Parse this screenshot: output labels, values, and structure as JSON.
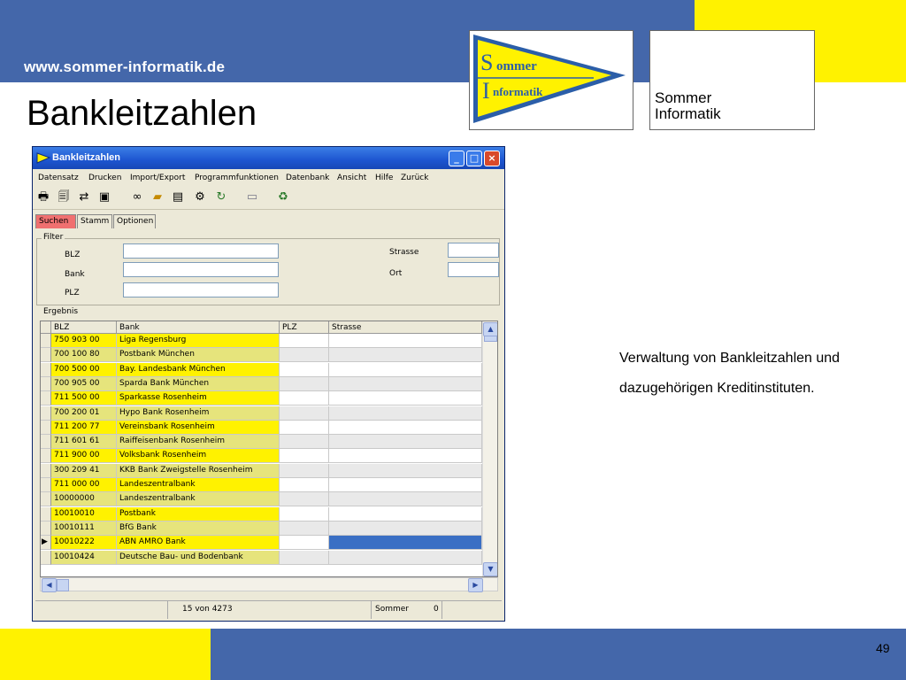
{
  "slide": {
    "site_url": "www.sommer-informatik.de",
    "title": "Bankleitzahlen",
    "page_number": "49",
    "description": [
      "Verwaltung von Bankleitzahlen und",
      "dazugehörigen Kreditinstituten."
    ],
    "logo_pennant": {
      "line1_initial": "S",
      "line1_rest": "ommer",
      "line2_initial": "I",
      "line2_rest": "nformatik"
    },
    "logo_text": {
      "line1": "Sommer",
      "line2": "Informatik"
    },
    "colors": {
      "blue": "#4467aa",
      "yellow": "#fff200"
    }
  },
  "window": {
    "title": "Bankleitzahlen",
    "menu": [
      "Datensatz",
      "Drucken",
      "Import/Export",
      "Programmfunktionen",
      "Datenbank",
      "Ansicht",
      "Hilfe",
      "Zurück"
    ],
    "toolbar_icons": [
      "print-icon",
      "print-preview-icon",
      "network-icon",
      "excel-icon",
      "binoculars-icon",
      "folder-refresh-icon",
      "document-icon",
      "gear-icon",
      "refresh-icon",
      "save-icon",
      "recycle-bin-icon"
    ],
    "tabs": [
      "Suchen",
      "Stamm",
      "Optionen"
    ],
    "filter": {
      "legend": "Filter",
      "blz_label": "BLZ",
      "bank_label": "Bank",
      "plz_label": "PLZ",
      "strasse_label": "Strasse",
      "ort_label": "Ort",
      "blz_value": "",
      "bank_value": "",
      "plz_value": "",
      "strasse_value": "",
      "ort_value": ""
    },
    "results": {
      "legend": "Ergebnis",
      "columns": [
        "BLZ",
        "Bank",
        "PLZ",
        "Strasse"
      ],
      "rows": [
        {
          "blz": "750 903 00",
          "bank": "Liga Regensburg"
        },
        {
          "blz": "700 100 80",
          "bank": "Postbank München"
        },
        {
          "blz": "700 500 00",
          "bank": "Bay. Landesbank München"
        },
        {
          "blz": "700 905 00",
          "bank": "Sparda Bank München"
        },
        {
          "blz": "711 500 00",
          "bank": "Sparkasse Rosenheim"
        },
        {
          "blz": "700 200 01",
          "bank": "Hypo Bank Rosenheim"
        },
        {
          "blz": "711 200 77",
          "bank": "Vereinsbank Rosenheim"
        },
        {
          "blz": "711 601 61",
          "bank": "Raiffeisenbank Rosenheim"
        },
        {
          "blz": "711 900 00",
          "bank": "Volksbank Rosenheim"
        },
        {
          "blz": "300 209 41",
          "bank": "KKB Bank Zweigstelle Rosenheim"
        },
        {
          "blz": "711 000 00",
          "bank": "Landeszentralbank"
        },
        {
          "blz": "10000000",
          "bank": "Landeszentralbank"
        },
        {
          "blz": "10010010",
          "bank": "Postbank"
        },
        {
          "blz": "10010111",
          "bank": "BfG Bank"
        },
        {
          "blz": "10010222",
          "bank": "ABN AMRO Bank"
        },
        {
          "blz": "10010424",
          "bank": "Deutsche Bau- und Bodenbank"
        }
      ],
      "selected_row": 14
    },
    "status": {
      "record": "15  von  4273",
      "user": "Sommer",
      "count": "0"
    }
  }
}
